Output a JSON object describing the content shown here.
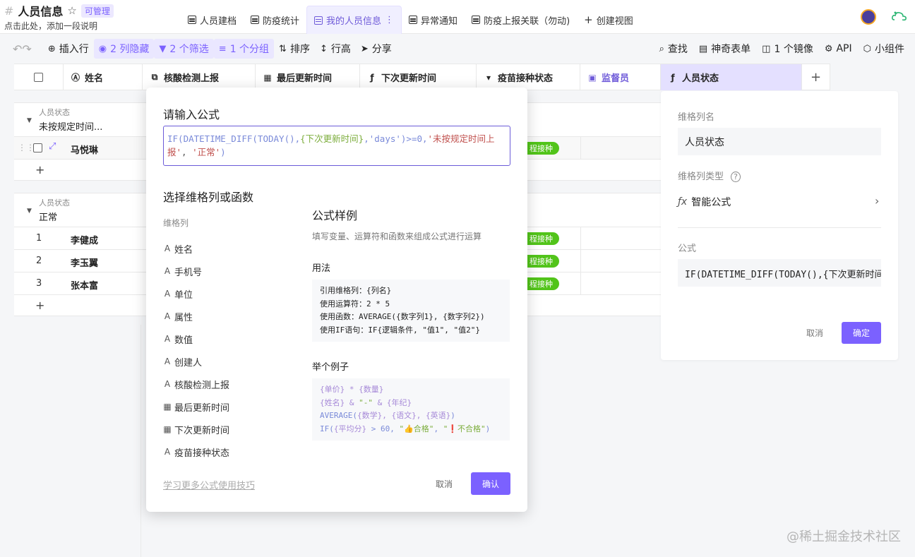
{
  "app": {
    "title": "人员信息",
    "permission_badge": "可管理",
    "subtitle": "点击此处，添加一段说明"
  },
  "tabs": [
    {
      "label": "人员建档",
      "active": false
    },
    {
      "label": "防疫统计",
      "active": false
    },
    {
      "label": "我的人员信息",
      "active": true
    },
    {
      "label": "异常通知",
      "active": false
    },
    {
      "label": "防疫上报关联（勿动)",
      "active": false
    }
  ],
  "create_view_label": "创建视图",
  "toolbar": {
    "insert_row": "插入行",
    "hidden_cols": "2 列隐藏",
    "filters": "2 个筛选",
    "groups": "1 个分组",
    "sort": "排序",
    "row_height": "行高",
    "share": "分享",
    "find": "查找",
    "magic_form": "神奇表单",
    "mirror": "1 个镜像",
    "api": "API",
    "widget": "小组件"
  },
  "columns": [
    "姓名",
    "核酸检测上报",
    "最后更新时间",
    "下次更新时间",
    "疫苗接种状态",
    "监督员",
    "人员状态"
  ],
  "groups": [
    {
      "label": "人员状态",
      "value": "未按规定时间...",
      "rows": [
        {
          "num": "",
          "name": "马悦琳",
          "vaccine": "程接种"
        }
      ]
    },
    {
      "label": "人员状态",
      "value": "正常",
      "rows": [
        {
          "num": "1",
          "name": "李健成",
          "vaccine": "程接种"
        },
        {
          "num": "2",
          "name": "李玉翼",
          "vaccine": "程接种"
        },
        {
          "num": "3",
          "name": "张本富",
          "vaccine": "程接种"
        }
      ]
    }
  ],
  "formula_modal": {
    "title": "请输入公式",
    "formula_parts": [
      "IF(DATETIME_DIFF(TODAY(),",
      "{下次更新时间}",
      ",'days')>=0,",
      "'未按规定时间上报'",
      ", ",
      "'正常'",
      ")"
    ],
    "select_title": "选择维格列或函数",
    "fields_header": "维格列",
    "fields": [
      {
        "name": "姓名",
        "icon": "text-icon"
      },
      {
        "name": "手机号",
        "icon": "text-icon"
      },
      {
        "name": "单位",
        "icon": "text-icon"
      },
      {
        "name": "属性",
        "icon": "text-icon"
      },
      {
        "name": "数值",
        "icon": "text-icon"
      },
      {
        "name": "创建人",
        "icon": "text-icon"
      },
      {
        "name": "核酸检测上报",
        "icon": "text-icon"
      },
      {
        "name": "最后更新时间",
        "icon": "calendar-icon"
      },
      {
        "name": "下次更新时间",
        "icon": "calendar-icon"
      },
      {
        "name": "疫苗接种状态",
        "icon": "text-icon"
      }
    ],
    "sample_title": "公式样例",
    "sample_desc": "填写变量、运算符和函数来组成公式进行运算",
    "usage_title": "用法",
    "usage_lines": [
      "引用维格列：{列名}",
      "使用运算符：2 * 5",
      "使用函数：AVERAGE({数字列1}, {数字列2})",
      "使用IF语句：IF{逻辑条件, \"值1\", \"值2\"}"
    ],
    "example_title": "举个例子",
    "learn_more": "学习更多公式使用技巧",
    "cancel": "取消",
    "confirm": "确认"
  },
  "side_panel": {
    "col_name_label": "维格列名",
    "col_name": "人员状态",
    "col_type_label": "维格列类型",
    "col_type": "智能公式",
    "formula_label": "公式",
    "formula": "IF(DATETIME_DIFF(TODAY(),{下次更新时间},'days')>=0,'未按规定时间上报','正常')",
    "cancel": "取消",
    "ok": "确定"
  },
  "watermark": "@稀土掘金技术社区",
  "colors": {
    "accent": "#7b61ff",
    "vaccine_badge": "#52c41a"
  }
}
